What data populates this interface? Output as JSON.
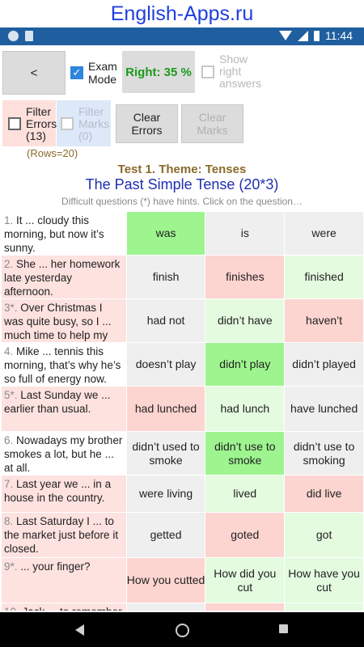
{
  "banner": "English-Apps.ru",
  "status_bar": {
    "time": "11:44"
  },
  "controls": {
    "back_label": "<",
    "exam_mode_label": "Exam\nMode",
    "exam_mode_checked": true,
    "right_label": "Right: 35 %",
    "show_answers_label": "Show\nright\nanswers",
    "filter_errors_label": "Filter\nErrors\n(13)",
    "filter_marks_label": "Filter\nMarks\n(0)",
    "rows_label": "(Rows=20)",
    "clear_errors_label": "Clear\nErrors",
    "clear_marks_label": "Clear\nMarks"
  },
  "header": {
    "test_title": "Test 1. Theme: Tenses",
    "topic": "The Past Simple Tense (20*3)",
    "hint": "Difficult questions (*) have hints. Click on the question…"
  },
  "questions": [
    {
      "num": "1.",
      "text": " It ... cloudy this morning, but now it’s sunny.",
      "state": "ok",
      "h": 53,
      "answers": [
        {
          "text": "was",
          "c": "g"
        },
        {
          "text": "is",
          "c": "gy"
        },
        {
          "text": "were",
          "c": "gy"
        }
      ]
    },
    {
      "num": "2.",
      "text": " She ... her homework late yesterday afternoon.",
      "state": "err",
      "h": 53,
      "answers": [
        {
          "text": "finish",
          "c": "gy"
        },
        {
          "text": "finishes",
          "c": "pk"
        },
        {
          "text": "finished",
          "c": "lg"
        }
      ]
    },
    {
      "num": "3*.",
      "text": " Over Christmas I was quite busy, so I ... much time to help my wife.",
      "state": "err",
      "h": 53,
      "answers": [
        {
          "text": "had not",
          "c": "gy"
        },
        {
          "text": "didn’t have",
          "c": "lg"
        },
        {
          "text": "haven’t",
          "c": "pk"
        }
      ]
    },
    {
      "num": "4.",
      "text": " Mike ... tennis this morning, that’s why he’s so full of energy now.",
      "state": "ok",
      "h": 53,
      "answers": [
        {
          "text": "doesn’t play",
          "c": "gy"
        },
        {
          "text": "didn’t play",
          "c": "g"
        },
        {
          "text": "didn’t played",
          "c": "gy"
        }
      ]
    },
    {
      "num": "5*.",
      "text": " Last Sunday we ... earlier than usual.",
      "state": "err",
      "h": 55,
      "answers": [
        {
          "text": "had lunched",
          "c": "pk"
        },
        {
          "text": "had lunch",
          "c": "lg"
        },
        {
          "text": "have lunched",
          "c": "gy"
        }
      ]
    },
    {
      "num": "6.",
      "text": " Nowadays my brother smokes a lot, but he ... at all.",
      "state": "ok",
      "h": 53,
      "answers": [
        {
          "text": "didn’t used to smoke",
          "c": "gy"
        },
        {
          "text": "didn’t use to smoke",
          "c": "g"
        },
        {
          "text": "didn’t use to smoking",
          "c": "gy"
        }
      ]
    },
    {
      "num": "7.",
      "text": " Last year we ... in a house in the country.",
      "state": "err",
      "h": 45,
      "answers": [
        {
          "text": "were living",
          "c": "gy"
        },
        {
          "text": "lived",
          "c": "lg"
        },
        {
          "text": "did live",
          "c": "pk"
        }
      ]
    },
    {
      "num": "8.",
      "text": " Last Saturday I ... to the market just before it closed.",
      "state": "err",
      "h": 55,
      "answers": [
        {
          "text": "getted",
          "c": "gy"
        },
        {
          "text": "goted",
          "c": "pk"
        },
        {
          "text": "got",
          "c": "lg"
        }
      ]
    },
    {
      "num": "9*.",
      "text": " ... your finger?",
      "state": "err",
      "h": 55,
      "answers": [
        {
          "text": "How you cutted",
          "c": "pk"
        },
        {
          "text": "How did you cut",
          "c": "lg"
        },
        {
          "text": "How have you cut",
          "c": "lg"
        }
      ]
    },
    {
      "num": "10.",
      "text": " Jack ... to remember",
      "state": "err",
      "h": 9,
      "answers": [
        {
          "text": "",
          "c": "gy"
        },
        {
          "text": "",
          "c": "pk"
        },
        {
          "text": "",
          "c": "lg"
        }
      ]
    }
  ]
}
